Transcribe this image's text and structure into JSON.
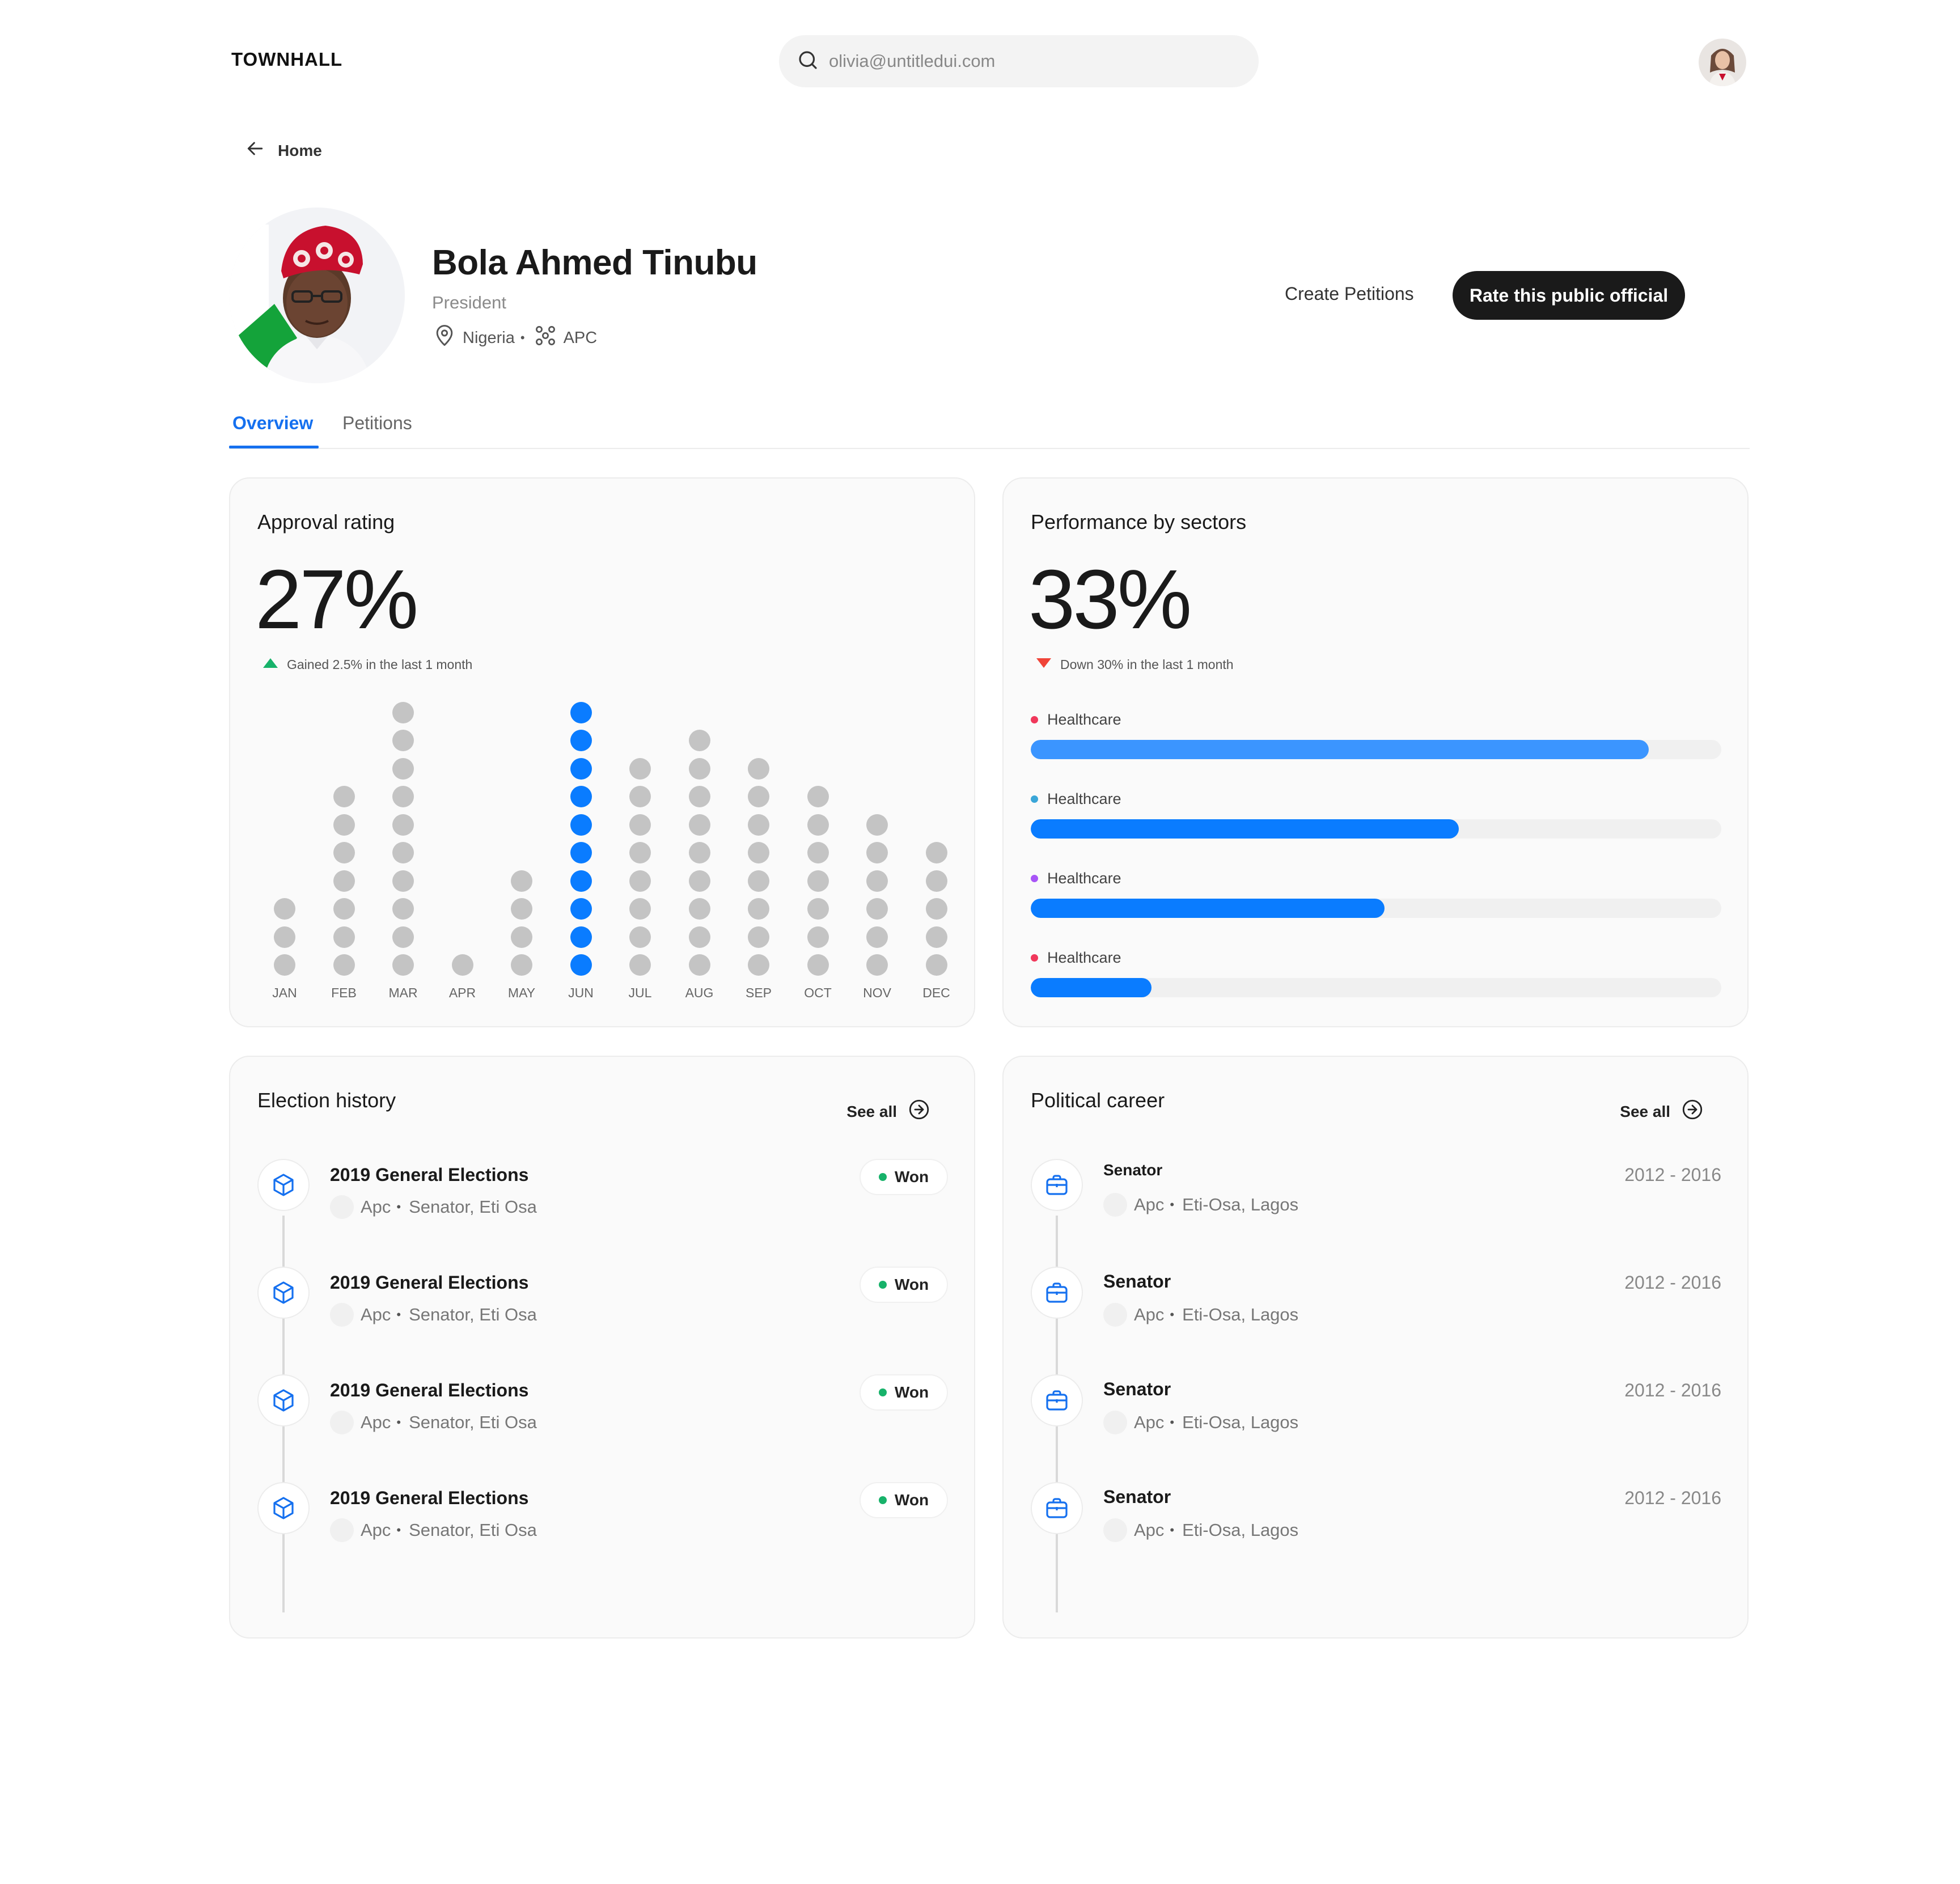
{
  "header": {
    "logo": "TOWNHALL",
    "search_value": "olivia@untitledui.com"
  },
  "nav": {
    "back_label": "Home"
  },
  "profile": {
    "name": "Bola Ahmed Tinubu",
    "role": "President",
    "country": "Nigeria",
    "party": "APC"
  },
  "actions": {
    "create_petitions": "Create Petitions",
    "rate_official": "Rate this public official"
  },
  "tabs": [
    {
      "label": "Overview",
      "active": true
    },
    {
      "label": "Petitions",
      "active": false
    }
  ],
  "approval": {
    "title": "Approval rating",
    "value": "27%",
    "trend_text": "Gained 2.5% in the last 1 month",
    "trend_color": "#17b26a",
    "chart_data": {
      "type": "scatter",
      "categories": [
        "JAN",
        "FEB",
        "MAR",
        "APR",
        "MAY",
        "JUN",
        "JUL",
        "AUG",
        "SEP",
        "OCT",
        "NOV",
        "DEC"
      ],
      "values": [
        3,
        7,
        10,
        1,
        4,
        10,
        8,
        9,
        8,
        7,
        6,
        5
      ],
      "highlight_index": 5,
      "highlight_color": "#0a7cff",
      "default_color": "#c4c4c4"
    }
  },
  "performance": {
    "title": "Performance by sectors",
    "value": "33%",
    "trend_text": "Down 30% in the last 1 month",
    "trend_color": "#f04438",
    "chart_data": {
      "type": "bar",
      "categories": [
        "Healthcare",
        "Healthcare",
        "Healthcare",
        "Healthcare"
      ],
      "values": [
        0.895,
        0.62,
        0.512,
        0.175
      ],
      "dot_colors": [
        "#f0385b",
        "#3aa6d8",
        "#a855f7",
        "#f0385b"
      ],
      "bar_colors": [
        "#3b95ff",
        "#0a7cff",
        "#0a7cff",
        "#0a7cff"
      ]
    }
  },
  "election_history": {
    "title": "Election history",
    "see_all": "See all",
    "items": [
      {
        "title": "2019 General Elections",
        "party": "Apc",
        "position": "Senator, Eti Osa",
        "result": "Won"
      },
      {
        "title": "2019 General Elections",
        "party": "Apc",
        "position": "Senator, Eti Osa",
        "result": "Won"
      },
      {
        "title": "2019 General Elections",
        "party": "Apc",
        "position": "Senator, Eti Osa",
        "result": "Won"
      },
      {
        "title": "2019 General Elections",
        "party": "Apc",
        "position": "Senator, Eti Osa",
        "result": "Won"
      }
    ]
  },
  "political_career": {
    "title": "Political career",
    "see_all": "See all",
    "items": [
      {
        "title": "Senator",
        "party": "Apc",
        "location": "Eti-Osa, Lagos",
        "period": "2012 - 2016"
      },
      {
        "title": "Senator",
        "party": "Apc",
        "location": "Eti-Osa, Lagos",
        "period": "2012 - 2016"
      },
      {
        "title": "Senator",
        "party": "Apc",
        "location": "Eti-Osa, Lagos",
        "period": "2012 - 2016"
      },
      {
        "title": "Senator",
        "party": "Apc",
        "location": "Eti-Osa, Lagos",
        "period": "2012 - 2016"
      }
    ]
  }
}
